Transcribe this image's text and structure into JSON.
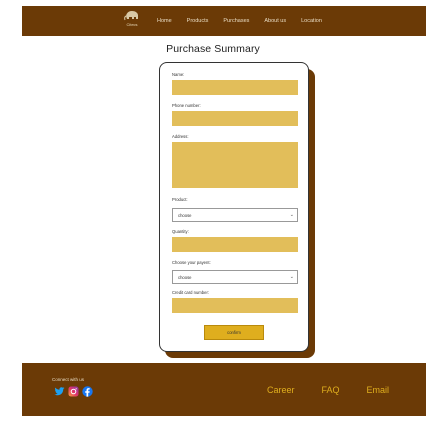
{
  "header": {
    "logo_text": "Citecs",
    "nav": [
      "Home",
      "Products",
      "Purchases",
      "About us",
      "Location"
    ]
  },
  "title": "Purchase Summary",
  "form": {
    "name_label": "Name:",
    "phone_label": "Phone number:",
    "address_label": "Address:",
    "product_label": "Product:",
    "product_value": "choose",
    "quantity_label": "Quantity:",
    "payment_label": "Choose your payent:",
    "payment_value": "choose",
    "card_label": "Credit card number:",
    "confirm_label": "confirm"
  },
  "footer": {
    "connect": "Connect with us",
    "socials": [
      "twitter-icon",
      "instagram-icon",
      "facebook-icon"
    ],
    "links": [
      "Career",
      "FAQ",
      "Email"
    ]
  },
  "colors": {
    "brand_brown": "#6b3a06",
    "field_yellow": "#e2be5a",
    "button_gold": "#dfae1e",
    "link_gold": "#dfae1e"
  }
}
